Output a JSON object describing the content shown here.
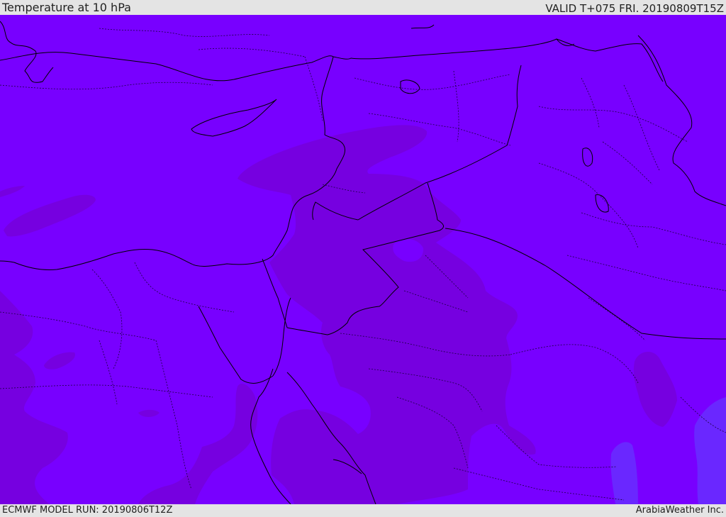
{
  "header": {
    "title": "Temperature at 10 hPa",
    "valid": "VALID T+075 FRI. 20190809T15Z"
  },
  "footer": {
    "model_run": "ECMWF MODEL RUN: 20190806T12Z",
    "credit": "ArabiaWeather Inc."
  },
  "colors": {
    "background_field": "#7800ff",
    "darker_field": "#7600e0",
    "cooler_field": "#6a27ff",
    "borders": "#000000",
    "bars": "#e4e4e4"
  }
}
